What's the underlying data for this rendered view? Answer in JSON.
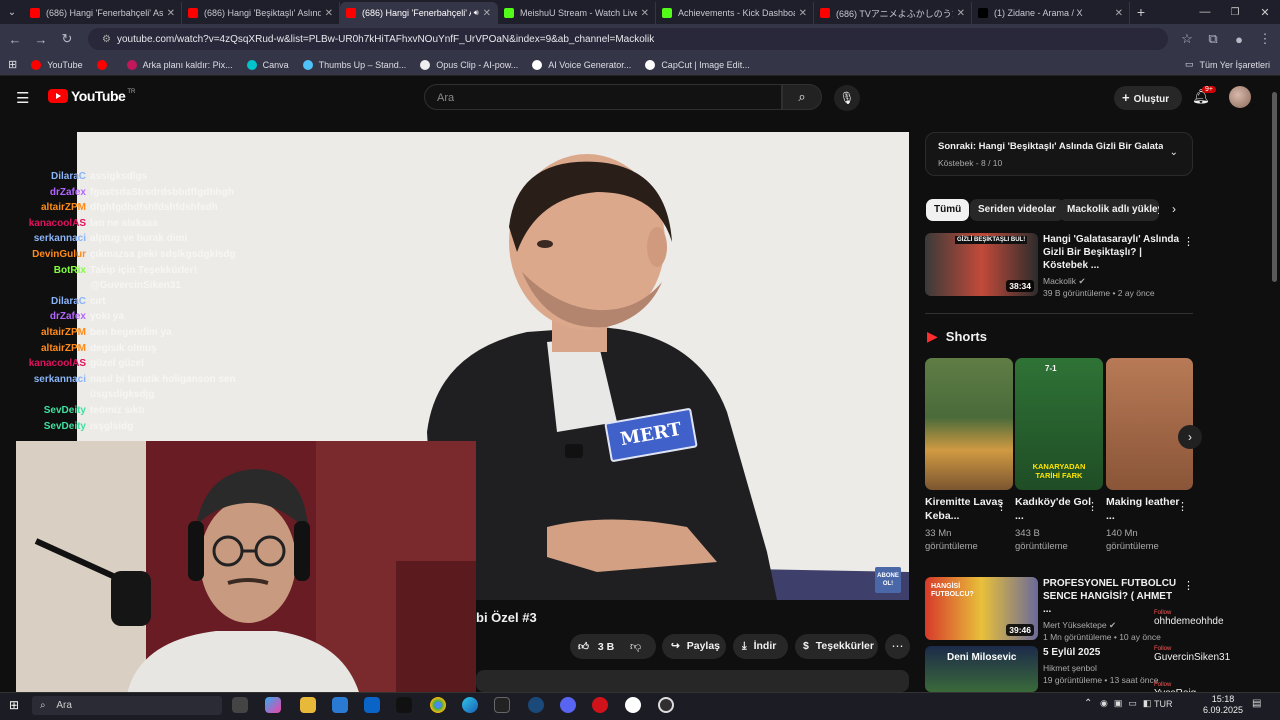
{
  "tabs": [
    {
      "label": "(686) Hangi 'Fenerbahçeli' Aslında",
      "color": "#ff0000",
      "active": false
    },
    {
      "label": "(686) Hangi 'Beşiktaşlı' Aslında",
      "color": "#ff0000",
      "active": false
    },
    {
      "label": "(686) Hangi 'Fenerbahçeli' Aslında",
      "color": "#ff0000",
      "active": true
    },
    {
      "label": "MeishuU Stream - Watch Live on",
      "color": "#53fc18",
      "active": false
    },
    {
      "label": "Achievements - Kick Dashboard",
      "color": "#53fc18",
      "active": false
    },
    {
      "label": "(686) TVアニメよふかしのうた Season",
      "color": "#ff0000",
      "active": false
    },
    {
      "label": "(1) Zidane - Arama / X",
      "color": "#000000",
      "active": false
    }
  ],
  "address": {
    "url": "youtube.com/watch?v=4zQsqXRud-w&list=PLBw-UR0h7kHiTAFhxvNOuYnfF_UrVPOaN&index=9&ab_channel=Mackolik"
  },
  "bookmarks": [
    {
      "label": "YouTube",
      "color": "#ff0000"
    },
    {
      "label": "",
      "color": "#ff0000"
    },
    {
      "label": "Arka planı kaldır: Pix...",
      "color": "#c2185b"
    },
    {
      "label": "Canva",
      "color": "#00c4cc"
    },
    {
      "label": "Thumbs Up – Stand...",
      "color": "#4fc3f7"
    },
    {
      "label": "Opus Clip - AI-pow...",
      "color": "#eeeeee"
    },
    {
      "label": "AI Voice Generator...",
      "color": "#ffffff"
    },
    {
      "label": "CapCut | Image Edit...",
      "color": "#ffffff"
    }
  ],
  "bookmarks_right": "Tüm Yer İşaretleri",
  "youtube": {
    "logo": "YouTube",
    "region": "TR",
    "search_placeholder": "Ara",
    "create_label": "Oluştur",
    "notif_count": "9+"
  },
  "video": {
    "nameplate": "MERT",
    "subscribe_badge": "ABONE OL!",
    "title_visible": "bi Özel #3"
  },
  "actions": {
    "likes": "3 B",
    "share": "Paylaş",
    "download": "İndir",
    "thanks": "Teşekkürler"
  },
  "next_card": {
    "title": "Sonraki: Hangi 'Beşiktaşlı' Aslında Gizli Bir Galatasa...",
    "sub": "Köstebek - 8 / 10"
  },
  "chips": [
    "Tümü",
    "Seriden videolar",
    "Mackolik adlı yükleyici"
  ],
  "rec1": {
    "title": "Hangi 'Galatasaraylı' Aslında Gizli Bir Beşiktaşlı? | Köstebek ...",
    "channel": "Mackolik",
    "meta": "39 B görüntüleme • 2 ay önce",
    "duration": "38:34",
    "thumb_text": "GİZLİ BEŞİKTAŞLI BUL!"
  },
  "shorts_heading": "Shorts",
  "shorts": [
    {
      "title": "Kiremitte Lavaş Keba...",
      "meta": "33 Mn görüntüleme",
      "colors": [
        "#4a6b3a",
        "#c8963c"
      ]
    },
    {
      "title": "Kadıköy'de Gol ...",
      "meta": "343 B görüntüleme",
      "colors": [
        "#2d6b34",
        "#1f4d25"
      ],
      "overlay": "KANARYADAN TARİHİ FARK",
      "score": "7-1"
    },
    {
      "title": "Making leather ...",
      "meta": "140 Mn görüntüleme",
      "colors": [
        "#a86a4a",
        "#7a4a32"
      ]
    }
  ],
  "rec2": {
    "title": "PROFESYONEL FUTBOLCU SENCE HANGİSİ? ( AHMET ...",
    "channel": "Mert Yüksektepe",
    "meta": "1 Mn görüntüleme • 10 ay önce",
    "duration": "39:46",
    "thumb_text": "HANGİSİ FUTBOLCU?"
  },
  "rec3": {
    "title": "5 Eylül 2025",
    "channel": "Hikmet şenbol",
    "meta": "19 görüntüleme • 13 saat önce",
    "thumb_text": "Deni Milosevic"
  },
  "chat": [
    {
      "user": "DilaraC",
      "msg": "assigksdlgs",
      "color": "#8ab4f8"
    },
    {
      "user": "drZafex",
      "msg": "fgastsdaStrsdrdsbbdffgdhhgh",
      "color": "#b366ff"
    },
    {
      "user": "altairZPM",
      "msg": "dfghfgdhdfshfdshfdshfsdh",
      "color": "#ff8c1a"
    },
    {
      "user": "kanacoolAS",
      "msg": "lan ne alakaaa",
      "color": "#e0115f"
    },
    {
      "user": "serkannaci",
      "msg": "alptug ve burak dimi",
      "color": "#8ab4f8"
    },
    {
      "user": "DevinGulur",
      "msg": "çıkmazsa peki sdşlkgsdgklsdg",
      "color": "#ff8c1a"
    },
    {
      "user": "BotRix",
      "msg": "Takip için Teşekkürler!",
      "color": "#80ff40"
    },
    {
      "user": "",
      "msg": "@GuvercinSiken31",
      "color": "#ffffff"
    },
    {
      "user": "DilaraC",
      "msg": "cırt",
      "color": "#8ab4f8"
    },
    {
      "user": "drZafex",
      "msg": "yokı ya",
      "color": "#b366ff"
    },
    {
      "user": "altairZPM",
      "msg": "ben begendim ya",
      "color": "#ff8c1a"
    },
    {
      "user": "altairZPM",
      "msg": "degisik olmuş",
      "color": "#ff8c1a"
    },
    {
      "user": "kanacoolAS",
      "msg": "güzel güzel",
      "color": "#e0115f"
    },
    {
      "user": "serkannaci",
      "msg": "nasıl bi fanatik holiganson sen",
      "color": "#8ab4f8"
    },
    {
      "user": "",
      "msg": "üsgsdigksdjg",
      "color": "#ffffff"
    },
    {
      "user": "SevDeity",
      "msg": "teömiz sıktı",
      "color": "#40e0a0"
    },
    {
      "user": "SevDeity",
      "msg": "ısşglsidg",
      "color": "#40e0a0"
    }
  ],
  "follows": [
    {
      "label": "Follow",
      "name": "ohhdemeohhde"
    },
    {
      "label": "Follow",
      "name": "GuvercinSiken31"
    },
    {
      "label": "Follow",
      "name": "YvesReig"
    }
  ],
  "taskbar": {
    "search": "Ara",
    "lang": "TUR",
    "time": "15:18",
    "date": "6.09.2025"
  }
}
